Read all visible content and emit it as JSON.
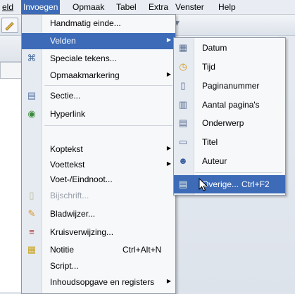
{
  "menubar": {
    "items": [
      "eld",
      "Invoegen",
      "Opmaak",
      "Tabel",
      "Extra",
      "Venster",
      "Help"
    ]
  },
  "insert_menu": {
    "items": [
      {
        "label": "Handmatig einde...",
        "icon": "none"
      },
      {
        "label": "Velden",
        "icon": "none",
        "submenu": true,
        "highlighted": true
      },
      {
        "label": "Speciale tekens...",
        "icon": "omega-icon"
      },
      {
        "label": "Opmaakmarkering",
        "icon": "none",
        "submenu": true
      },
      {
        "label": "Sectie...",
        "icon": "section-icon"
      },
      {
        "label": "Hyperlink",
        "icon": "hyperlink-globe-icon"
      },
      {
        "label": "Koptekst",
        "icon": "none",
        "submenu": true
      },
      {
        "label": "Voettekst",
        "icon": "none",
        "submenu": true
      },
      {
        "label": "Voet-/Eindnoot...",
        "icon": "none"
      },
      {
        "label": "Bijschrift...",
        "icon": "caption-icon",
        "disabled": true
      },
      {
        "label": "Bladwijzer...",
        "icon": "bookmark-icon"
      },
      {
        "label": "Kruisverwijzing...",
        "icon": "cross-reference-icon"
      },
      {
        "label": "Notitie",
        "shortcut": "Ctrl+Alt+N",
        "icon": "note-icon"
      },
      {
        "label": "Script...",
        "icon": "none"
      },
      {
        "label": "Inhoudsopgave en registers",
        "icon": "none",
        "submenu": true
      }
    ]
  },
  "fields_submenu": {
    "items": [
      {
        "label": "Datum",
        "icon": "calendar-icon"
      },
      {
        "label": "Tijd",
        "icon": "clock-icon"
      },
      {
        "label": "Paginanummer",
        "icon": "page-number-icon"
      },
      {
        "label": "Aantal pagina's",
        "icon": "page-count-icon"
      },
      {
        "label": "Onderwerp",
        "icon": "subject-icon"
      },
      {
        "label": "Titel",
        "icon": "title-icon"
      },
      {
        "label": "Auteur",
        "icon": "author-icon"
      },
      {
        "label": "Overige...",
        "shortcut": "Ctrl+F2",
        "icon": "other-fields-icon",
        "highlighted": true
      }
    ]
  },
  "colors": {
    "highlight": "#3d6bb8",
    "menu_bg": "#f7f8fa",
    "disabled_text": "#9aa0aa"
  }
}
